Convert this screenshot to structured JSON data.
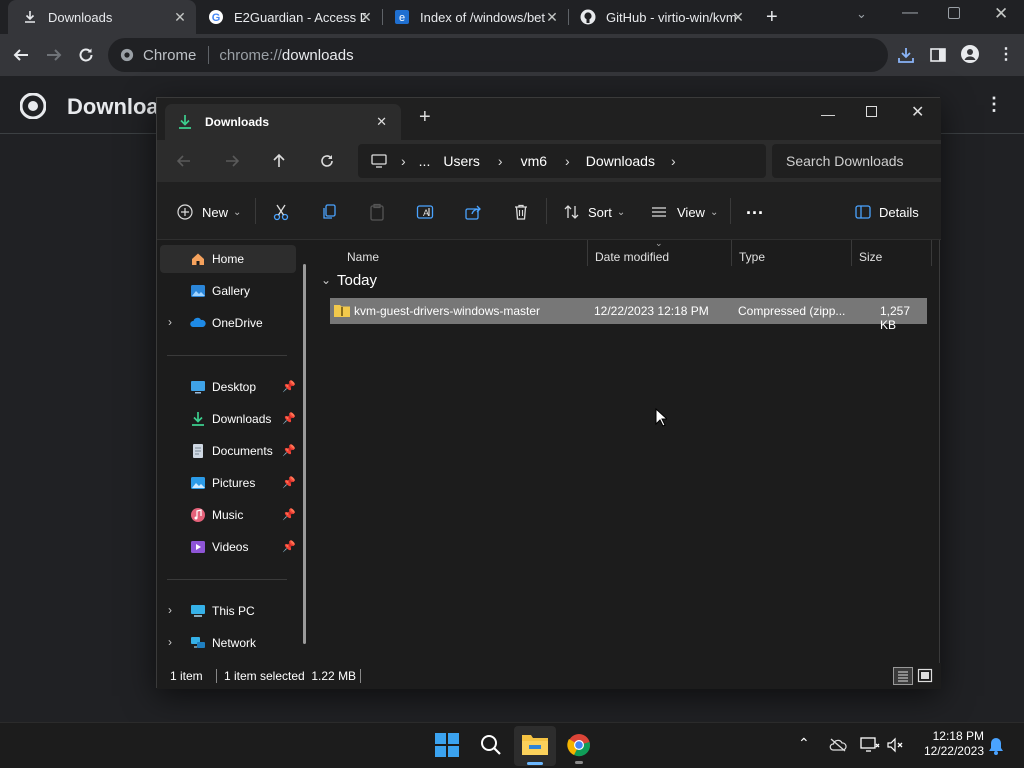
{
  "browser": {
    "tabs": [
      {
        "title": "Downloads",
        "icon": "download-icon"
      },
      {
        "title": "E2Guardian - Access De",
        "icon": "google-icon"
      },
      {
        "title": "Index of /windows/bet",
        "icon": "ie-icon"
      },
      {
        "title": "GitHub - virtio-win/kvm",
        "icon": "github-icon"
      }
    ],
    "omnibox": {
      "label": "Chrome",
      "url_scheme": "chrome://",
      "url_path": "downloads"
    },
    "page_title": "Downloa"
  },
  "explorer": {
    "tab_title": "Downloads",
    "breadcrumbs": [
      "...",
      "Users",
      "vm6",
      "Downloads"
    ],
    "search_placeholder": "Search Downloads",
    "commands": {
      "new": "New",
      "sort": "Sort",
      "view": "View",
      "more": "...",
      "details": "Details"
    },
    "nav_items": [
      {
        "label": "Home",
        "icon": "home-icon"
      },
      {
        "label": "Gallery",
        "icon": "gallery-icon"
      },
      {
        "label": "OneDrive",
        "icon": "onedrive-icon"
      },
      {
        "label": "Desktop",
        "icon": "desktop-icon"
      },
      {
        "label": "Downloads",
        "icon": "download-icon"
      },
      {
        "label": "Documents",
        "icon": "documents-icon"
      },
      {
        "label": "Pictures",
        "icon": "pictures-icon"
      },
      {
        "label": "Music",
        "icon": "music-icon"
      },
      {
        "label": "Videos",
        "icon": "videos-icon"
      },
      {
        "label": "This PC",
        "icon": "pc-icon"
      },
      {
        "label": "Network",
        "icon": "network-icon"
      }
    ],
    "columns": [
      "Name",
      "Date modified",
      "Type",
      "Size"
    ],
    "group_label": "Today",
    "files": [
      {
        "name": "kvm-guest-drivers-windows-master",
        "date": "12/22/2023 12:18 PM",
        "type": "Compressed (zipp...",
        "size": "1,257 KB"
      }
    ],
    "status": {
      "items": "1 item",
      "selected": "1 item selected  1.22 MB"
    }
  },
  "taskbar": {
    "time": "12:18 PM",
    "date": "12/22/2023"
  },
  "colors": {
    "accent": "#1a73e8",
    "selection": "#777777",
    "folder": "#f2c94c"
  }
}
